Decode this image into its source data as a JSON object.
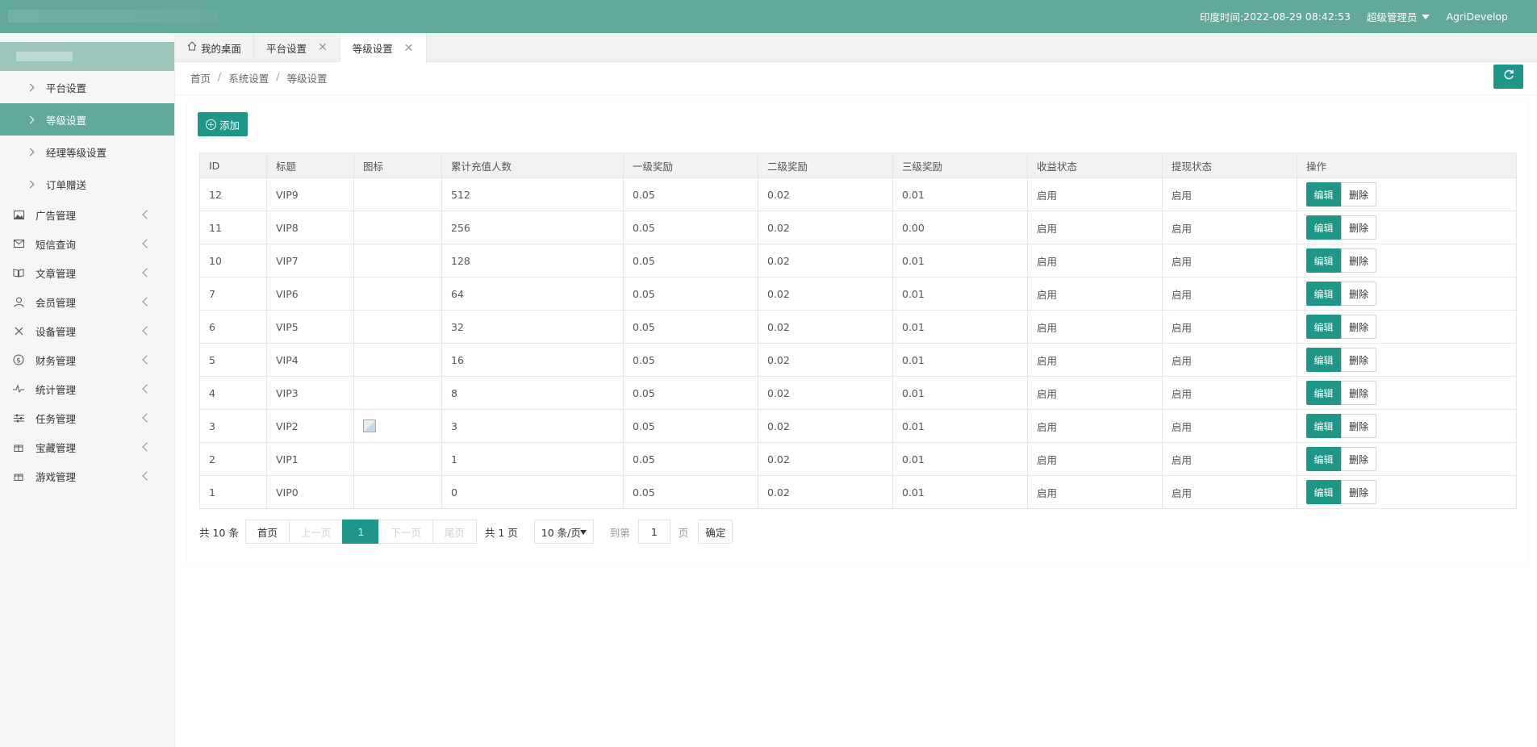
{
  "header": {
    "time_label": "印度时间:",
    "time_value": "2022-08-29 08:42:53",
    "role": "超级管理员",
    "user": "AgriDevelop"
  },
  "tabs": [
    {
      "label": "我的桌面",
      "icon": "home-icon"
    },
    {
      "label": "平台设置"
    },
    {
      "label": "等级设置",
      "active": true
    }
  ],
  "breadcrumb": [
    "首页",
    "系统设置",
    "等级设置"
  ],
  "sidebar": {
    "sub_items": [
      {
        "label": "平台设置"
      },
      {
        "label": "等级设置",
        "active": true
      },
      {
        "label": "经理等级设置"
      },
      {
        "label": "订单赠送"
      }
    ],
    "items": [
      {
        "label": "广告管理",
        "icon": "image-icon"
      },
      {
        "label": "短信查询",
        "icon": "mail-icon"
      },
      {
        "label": "文章管理",
        "icon": "book-icon"
      },
      {
        "label": "会员管理",
        "icon": "user-icon"
      },
      {
        "label": "设备管理",
        "icon": "tools-icon"
      },
      {
        "label": "财务管理",
        "icon": "dollar-icon"
      },
      {
        "label": "统计管理",
        "icon": "pulse-icon"
      },
      {
        "label": "任务管理",
        "icon": "sliders-icon"
      },
      {
        "label": "宝藏管理",
        "icon": "gift-icon"
      },
      {
        "label": "游戏管理",
        "icon": "gift-icon"
      }
    ]
  },
  "toolbar": {
    "add_label": "添加"
  },
  "table": {
    "columns": [
      "ID",
      "标题",
      "图标",
      "累计充值人数",
      "一级奖励",
      "二级奖励",
      "三级奖励",
      "收益状态",
      "提现状态",
      "操作"
    ],
    "rows": [
      {
        "id": "12",
        "title": "VIP9",
        "count": "512",
        "r1": "0.05",
        "r2": "0.02",
        "r3": "0.01",
        "s1": "启用",
        "s2": "启用"
      },
      {
        "id": "11",
        "title": "VIP8",
        "count": "256",
        "r1": "0.05",
        "r2": "0.02",
        "r3": "0.00",
        "s1": "启用",
        "s2": "启用"
      },
      {
        "id": "10",
        "title": "VIP7",
        "count": "128",
        "r1": "0.05",
        "r2": "0.02",
        "r3": "0.01",
        "s1": "启用",
        "s2": "启用"
      },
      {
        "id": "7",
        "title": "VIP6",
        "count": "64",
        "r1": "0.05",
        "r2": "0.02",
        "r3": "0.01",
        "s1": "启用",
        "s2": "启用"
      },
      {
        "id": "6",
        "title": "VIP5",
        "count": "32",
        "r1": "0.05",
        "r2": "0.02",
        "r3": "0.01",
        "s1": "启用",
        "s2": "启用"
      },
      {
        "id": "5",
        "title": "VIP4",
        "count": "16",
        "r1": "0.05",
        "r2": "0.02",
        "r3": "0.01",
        "s1": "启用",
        "s2": "启用"
      },
      {
        "id": "4",
        "title": "VIP3",
        "count": "8",
        "r1": "0.05",
        "r2": "0.02",
        "r3": "0.01",
        "s1": "启用",
        "s2": "启用"
      },
      {
        "id": "3",
        "title": "VIP2",
        "count": "3",
        "r1": "0.05",
        "r2": "0.02",
        "r3": "0.01",
        "s1": "启用",
        "s2": "启用",
        "has_icon": true
      },
      {
        "id": "2",
        "title": "VIP1",
        "count": "1",
        "r1": "0.05",
        "r2": "0.02",
        "r3": "0.01",
        "s1": "启用",
        "s2": "启用"
      },
      {
        "id": "1",
        "title": "VIP0",
        "count": "0",
        "r1": "0.05",
        "r2": "0.02",
        "r3": "0.01",
        "s1": "启用",
        "s2": "启用"
      }
    ],
    "edit_label": "编辑",
    "delete_label": "删除"
  },
  "pager": {
    "count_text": "共 10 条",
    "first": "首页",
    "prev": "上一页",
    "current": "1",
    "next": "下一页",
    "last": "尾页",
    "total_pages": "共 1 页",
    "page_size": "10 条/页",
    "goto_label": "到第",
    "goto_value": "1",
    "page_word": "页",
    "confirm": "确定"
  },
  "colors": {
    "header_bg": "#62a89b",
    "primary": "#1e9688",
    "status_green": "#5fb878"
  }
}
